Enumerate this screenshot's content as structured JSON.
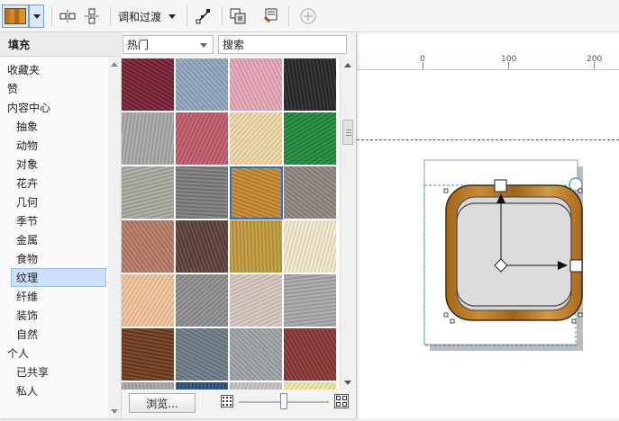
{
  "toolbar": {
    "blend_label": "调和过渡"
  },
  "ruler": {
    "labels": [
      "0",
      "100",
      "200"
    ]
  },
  "panel": {
    "title": "填充",
    "category_value": "热门",
    "search_placeholder": "搜索",
    "browse_label": "浏览...",
    "thumbnail_size": 0.5
  },
  "tree": {
    "items": [
      {
        "label": "收藏夹",
        "level": 0
      },
      {
        "label": "赞",
        "level": 0
      },
      {
        "label": "内容中心",
        "level": 0
      },
      {
        "label": "抽象",
        "level": 1
      },
      {
        "label": "动物",
        "level": 1
      },
      {
        "label": "对象",
        "level": 1
      },
      {
        "label": "花卉",
        "level": 1
      },
      {
        "label": "几何",
        "level": 1
      },
      {
        "label": "季节",
        "level": 1
      },
      {
        "label": "金属",
        "level": 1
      },
      {
        "label": "食物",
        "level": 1
      },
      {
        "label": "纹理",
        "level": 1,
        "selected": true
      },
      {
        "label": "纤维",
        "level": 1
      },
      {
        "label": "装饰",
        "level": 1
      },
      {
        "label": "自然",
        "level": 1
      },
      {
        "label": "个人",
        "level": 0
      },
      {
        "label": "已共享",
        "level": 1
      },
      {
        "label": "私人",
        "level": 1
      }
    ]
  },
  "textures": [
    "#7b1f35",
    "#8fa8be",
    "#e9a5b8",
    "#262626",
    "#a9a6a6",
    "#c45a6b",
    "#f0d8a8",
    "#1e8a3c",
    "#a9a9a2",
    "#7c7c7c",
    "#c8862e",
    "#8e867e",
    "#b87a66",
    "#5c4038",
    "#c29a3a",
    "#f3ebcc",
    "#f2c49a",
    "#8e8e8e",
    "#d7c7c0",
    "#a7a7a7",
    "#6e3a1c",
    "#6c7c89",
    "#9ea4a8",
    "#8a3434",
    "#a7a7a7",
    "#2c4e82",
    "#c4c4c4",
    "#f6e6a0"
  ]
}
